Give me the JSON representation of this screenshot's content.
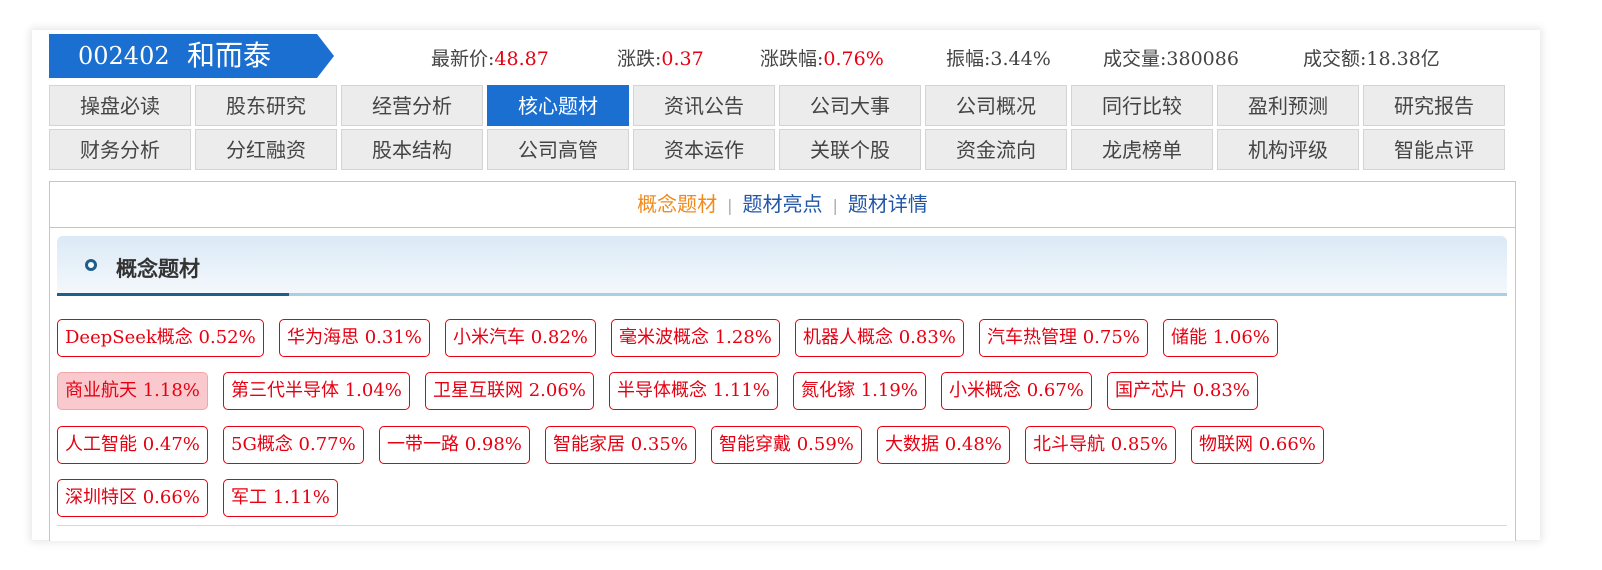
{
  "stock": {
    "code": "002402",
    "name": "和而泰"
  },
  "quotes": [
    {
      "label": "最新价:",
      "value": "48.87",
      "red": true
    },
    {
      "label": "涨跌:",
      "value": "0.37",
      "red": true
    },
    {
      "label": "涨跌幅:",
      "value": "0.76%",
      "red": true
    },
    {
      "label": "振幅:",
      "value": "3.44%",
      "red": false
    },
    {
      "label": "成交量:",
      "value": "380086",
      "red": false
    },
    {
      "label": "成交额:",
      "value": "18.38亿",
      "red": false
    }
  ],
  "tabs_row1": [
    "操盘必读",
    "股东研究",
    "经营分析",
    "核心题材",
    "资讯公告",
    "公司大事",
    "公司概况",
    "同行比较",
    "盈利预测",
    "研究报告"
  ],
  "tabs_row2": [
    "财务分析",
    "分红融资",
    "股本结构",
    "公司高管",
    "资本运作",
    "关联个股",
    "资金流向",
    "龙虎榜单",
    "机构评级",
    "智能点评"
  ],
  "active_tab": "核心题材",
  "subnav": {
    "items": [
      "概念题材",
      "题材亮点",
      "题材详情"
    ],
    "separator": "|",
    "active": "概念题材"
  },
  "section": {
    "title": "概念题材"
  },
  "concept_tags": [
    [
      "DeepSeek概念 0.52%",
      "华为海思 0.31%",
      "小米汽车 0.82%",
      "毫米波概念 1.28%",
      "机器人概念 0.83%",
      "汽车热管理 0.75%",
      "储能 1.06%"
    ],
    [
      "商业航天 1.18%",
      "第三代半导体 1.04%",
      "卫星互联网 2.06%",
      "半导体概念 1.11%",
      "氮化镓 1.19%",
      "小米概念 0.67%",
      "国产芯片 0.83%"
    ],
    [
      "人工智能 0.47%",
      "5G概念 0.77%",
      "一带一路 0.98%",
      "智能家居 0.35%",
      "智能穿戴 0.59%",
      "大数据 0.48%",
      "北斗导航 0.85%",
      "物联网 0.66%"
    ],
    [
      "深圳特区 0.66%",
      "军工 1.11%"
    ]
  ],
  "active_concept": "商业航天 1.18%",
  "colors": {
    "accent": "#1a6fd1",
    "up": "#e60012",
    "subnav_active": "#f08a1c",
    "subnav_link": "#2257a8"
  }
}
